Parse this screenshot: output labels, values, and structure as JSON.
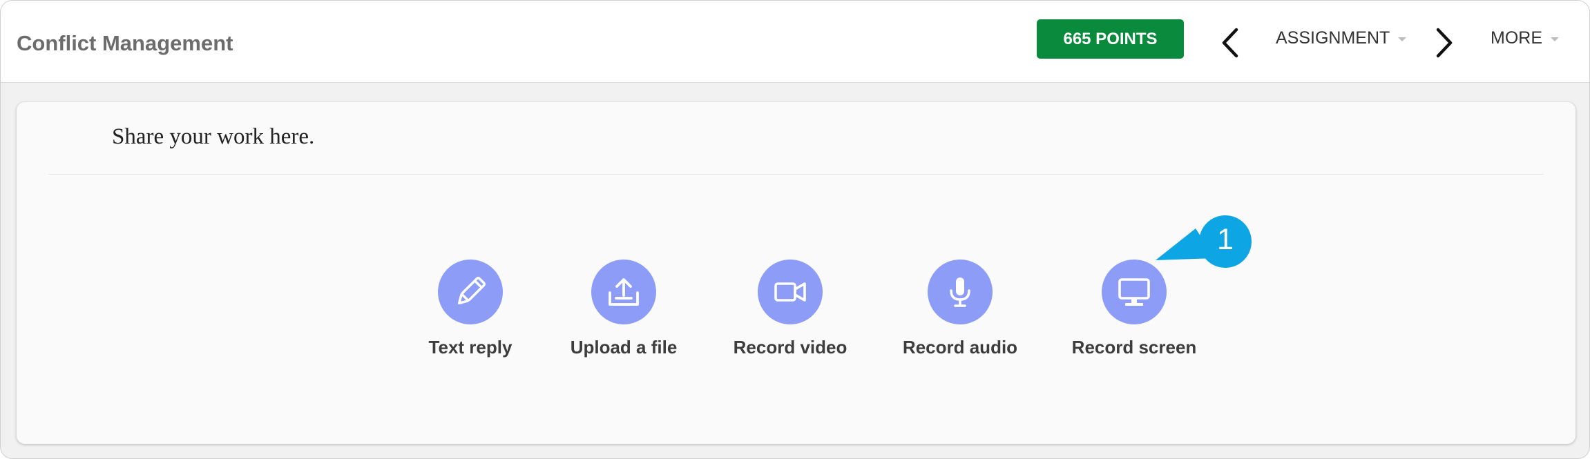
{
  "header": {
    "title": "Conflict Management",
    "points_label": "665 POINTS",
    "assignment_menu": "ASSIGNMENT",
    "more_menu": "MORE"
  },
  "main": {
    "prompt": "Share your work here.",
    "options": [
      {
        "label": "Text reply",
        "icon": "pencil-icon"
      },
      {
        "label": "Upload a file",
        "icon": "upload-icon"
      },
      {
        "label": "Record video",
        "icon": "video-camera-icon"
      },
      {
        "label": "Record audio",
        "icon": "microphone-icon"
      },
      {
        "label": "Record screen",
        "icon": "monitor-icon"
      }
    ]
  },
  "callout": {
    "number": "1"
  },
  "colors": {
    "points_bg": "#0a8a3d",
    "option_circle": "#8c9cf7",
    "callout": "#0ea5e4"
  }
}
